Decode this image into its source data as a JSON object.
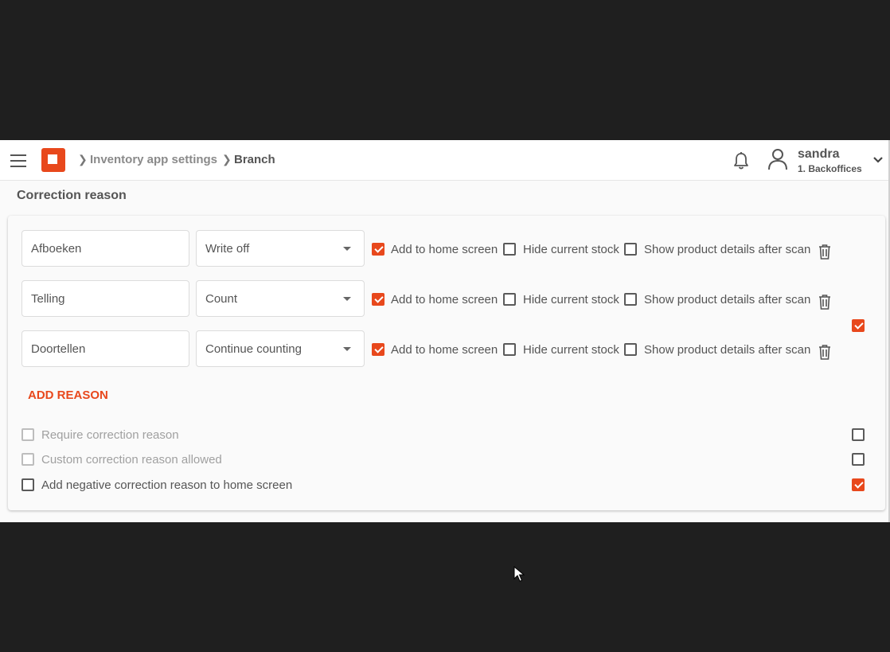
{
  "header": {
    "breadcrumb": [
      {
        "label": "Inventory app settings"
      },
      {
        "label": "Branch"
      }
    ],
    "user": {
      "name": "sandra",
      "org": "1. Backoffices"
    }
  },
  "section": {
    "title": "Correction reason",
    "add_reason_label": "ADD REASON",
    "reasons": [
      {
        "name": "Afboeken",
        "type": "Write off",
        "add_home": true,
        "hide_stock": false,
        "show_details": false,
        "add_home_label": "Add to home screen",
        "hide_stock_label": "Hide current stock",
        "show_details_label": "Show product details after scan"
      },
      {
        "name": "Telling",
        "type": "Count",
        "add_home": true,
        "hide_stock": false,
        "show_details": false,
        "add_home_label": "Add to home screen",
        "hide_stock_label": "Hide current stock",
        "show_details_label": "Show product details after scan"
      },
      {
        "name": "Doortellen",
        "type": "Continue counting",
        "add_home": true,
        "hide_stock": false,
        "show_details": false,
        "add_home_label": "Add to home screen",
        "hide_stock_label": "Hide current stock",
        "show_details_label": "Show product details after scan"
      }
    ],
    "reasons_override_checked": true,
    "options": [
      {
        "label": "Require correction reason",
        "checked": false,
        "disabled": true,
        "override_checked": false
      },
      {
        "label": "Custom correction reason allowed",
        "checked": false,
        "disabled": true,
        "override_checked": false
      },
      {
        "label": "Add negative correction reason to home screen",
        "checked": false,
        "disabled": false,
        "override_checked": true
      }
    ]
  },
  "colors": {
    "accent": "#e8481c",
    "topbar": "#ffffff",
    "backdrop": "#1f1f1f"
  }
}
